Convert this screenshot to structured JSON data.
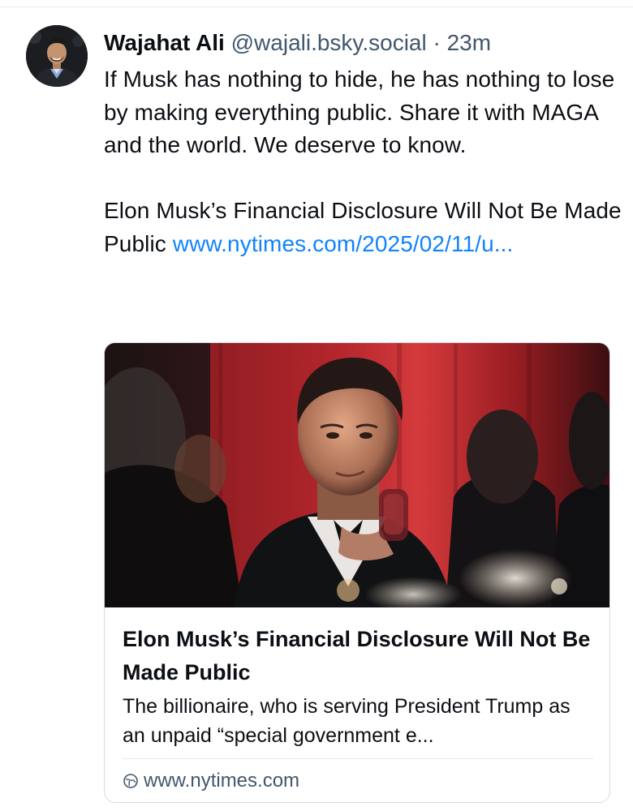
{
  "post": {
    "author_name": "Wajahat Ali",
    "handle": "@wajali.bsky.social",
    "separator": "·",
    "time": "23m",
    "avatar_icon": "user-avatar",
    "text_para1": "If Musk has nothing to hide, he has nothing to lose by making everything public. Share it with MAGA and the world. We deserve to know.",
    "text_para2": "Elon Musk’s Financial Disclosure Will Not Be Made Public",
    "link_text": "www.nytimes.com/2025/02/11/u..."
  },
  "embed": {
    "image_alt": "photo-of-elon-musk",
    "title": "Elon Musk’s Financial Disclosure Will Not Be Made Public",
    "description": "The billionaire, who is serving President Trump as an unpaid “special government e...",
    "domain_icon": "globe-icon",
    "domain": "www.nytimes.com"
  },
  "colors": {
    "link": "#1083fe",
    "muted": "#42576c",
    "text": "#0b0f14",
    "border": "#d4dbe2"
  }
}
